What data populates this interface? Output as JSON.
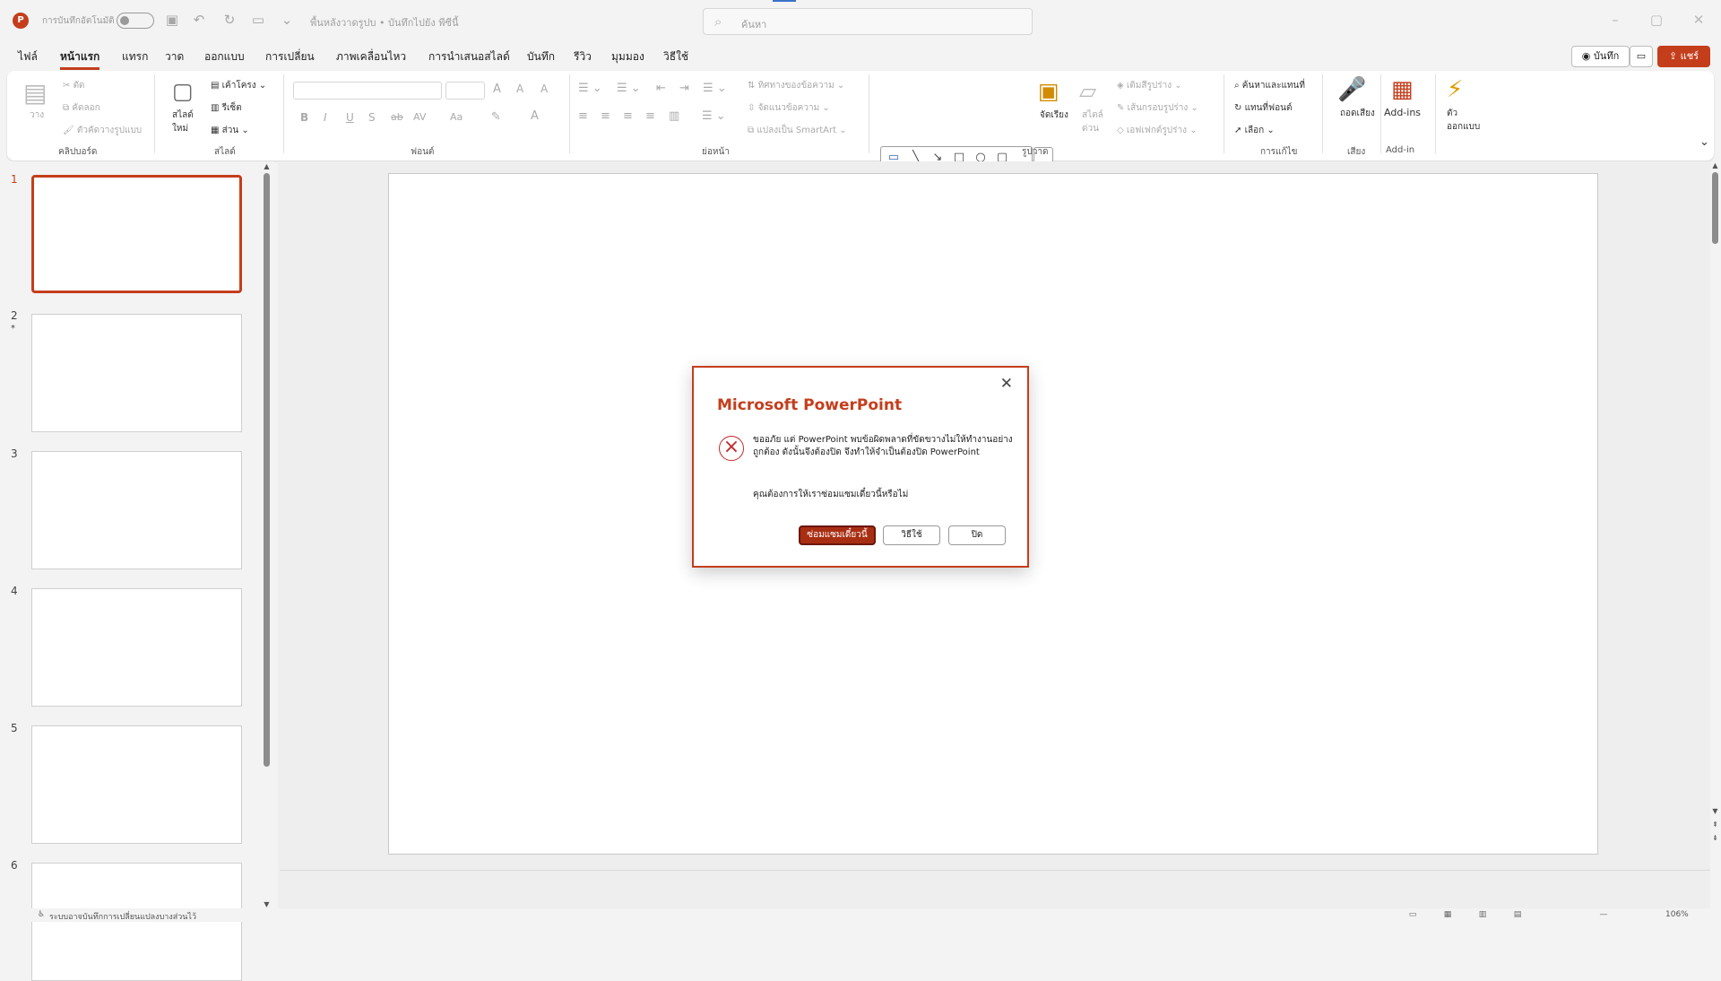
{
  "title_bar": {
    "app_icon": "P",
    "autosave_label": "การบันทึกอัตโนมัติ",
    "document_title": "พื้นหลังวาดรูปบ • บันทึกไปยัง พีซีนี้",
    "search_placeholder": "ค้นหา",
    "icons": [
      "powerpoint-logo",
      "save-icon",
      "undo-icon",
      "redo-icon",
      "present-icon",
      "customize-icon"
    ]
  },
  "menu": {
    "tabs": [
      "ไฟล์",
      "หน้าแรก",
      "แทรก",
      "วาด",
      "ออกแบบ",
      "การเปลี่ยน",
      "ภาพเคลื่อนไหว",
      "การนำเสนอสไลด์",
      "บันทึก",
      "รีวิว",
      "มุมมอง",
      "วิธีใช้"
    ],
    "active_tab": "หน้าแรก",
    "record_button": "บันทึก",
    "share_button": "แชร์"
  },
  "ribbon": {
    "clipboard": {
      "paste": "วาง",
      "cut": "ตัด",
      "copy": "คัดลอก",
      "format_painter": "ตัวคัดวางรูปแบบ",
      "group": "คลิปบอร์ด"
    },
    "slides": {
      "new_slide": "สไลด์ใหม่",
      "layout": "เค้าโครง",
      "reset": "รีเซ็ต",
      "section": "ส่วน",
      "group": "สไลด์"
    },
    "font": {
      "group": "ฟอนต์",
      "bold": "B",
      "italic": "I",
      "underline": "U",
      "shadow": "S",
      "strike": "ab",
      "spacing": "AV",
      "change_case": "Aa"
    },
    "paragraph": {
      "text_direction": "ทิศทางของข้อความ",
      "align_text": "จัดแนวข้อความ",
      "smartart": "แปลงเป็น SmartArt",
      "group": "ย่อหน้า"
    },
    "drawing": {
      "arrange": "จัดเรียง",
      "quick_styles": "สไตล์ด่วน",
      "shape_fill": "เติมสีรูปร่าง",
      "shape_outline": "เส้นกรอบรูปร่าง",
      "shape_effects": "เอฟเฟกต์รูปร่าง",
      "group": "รูปวาด"
    },
    "editing": {
      "find_replace": "ค้นหาและแทนที่",
      "replace_fonts": "แทนที่ฟอนต์",
      "select": "เลือก",
      "group": "การแก้ไข"
    },
    "voice": {
      "dictate": "ถอดเสียง",
      "group": "เสียง"
    },
    "addins": {
      "label": "Add-ins",
      "group": "Add-in"
    },
    "designer": {
      "label": "ตัวออกแบบ"
    }
  },
  "slides_panel": {
    "slides": [
      {
        "num": "1",
        "active": true
      },
      {
        "num": "2",
        "marker": "*"
      },
      {
        "num": "3"
      },
      {
        "num": "4"
      },
      {
        "num": "5"
      },
      {
        "num": "6"
      }
    ]
  },
  "dialog": {
    "title": "Microsoft PowerPoint",
    "message": "ขออภัย แต่ PowerPoint พบข้อผิดพลาดที่ขัดขวางไม่ให้ทำงานอย่างถูกต้อง ดังนั้นจึงต้องปิด จึงทำให้จำเป็นต้องปิด PowerPoint",
    "question": "คุณต้องการให้เราซ่อมแซมเดี๋ยวนี้หรือไม่",
    "buttons": {
      "repair": "ซ่อมแซมเดี๋ยวนี้",
      "help": "วิธีใช้",
      "close": "ปิด"
    }
  },
  "status_bar": {
    "message": "ระบบอาจบันทึกการเปลี่ยนแปลงบางส่วนไว้",
    "zoom": "106%"
  },
  "colors": {
    "accent": "#c43e1c",
    "dialog_button": "#a82e13",
    "background": "#f3f3f3"
  }
}
